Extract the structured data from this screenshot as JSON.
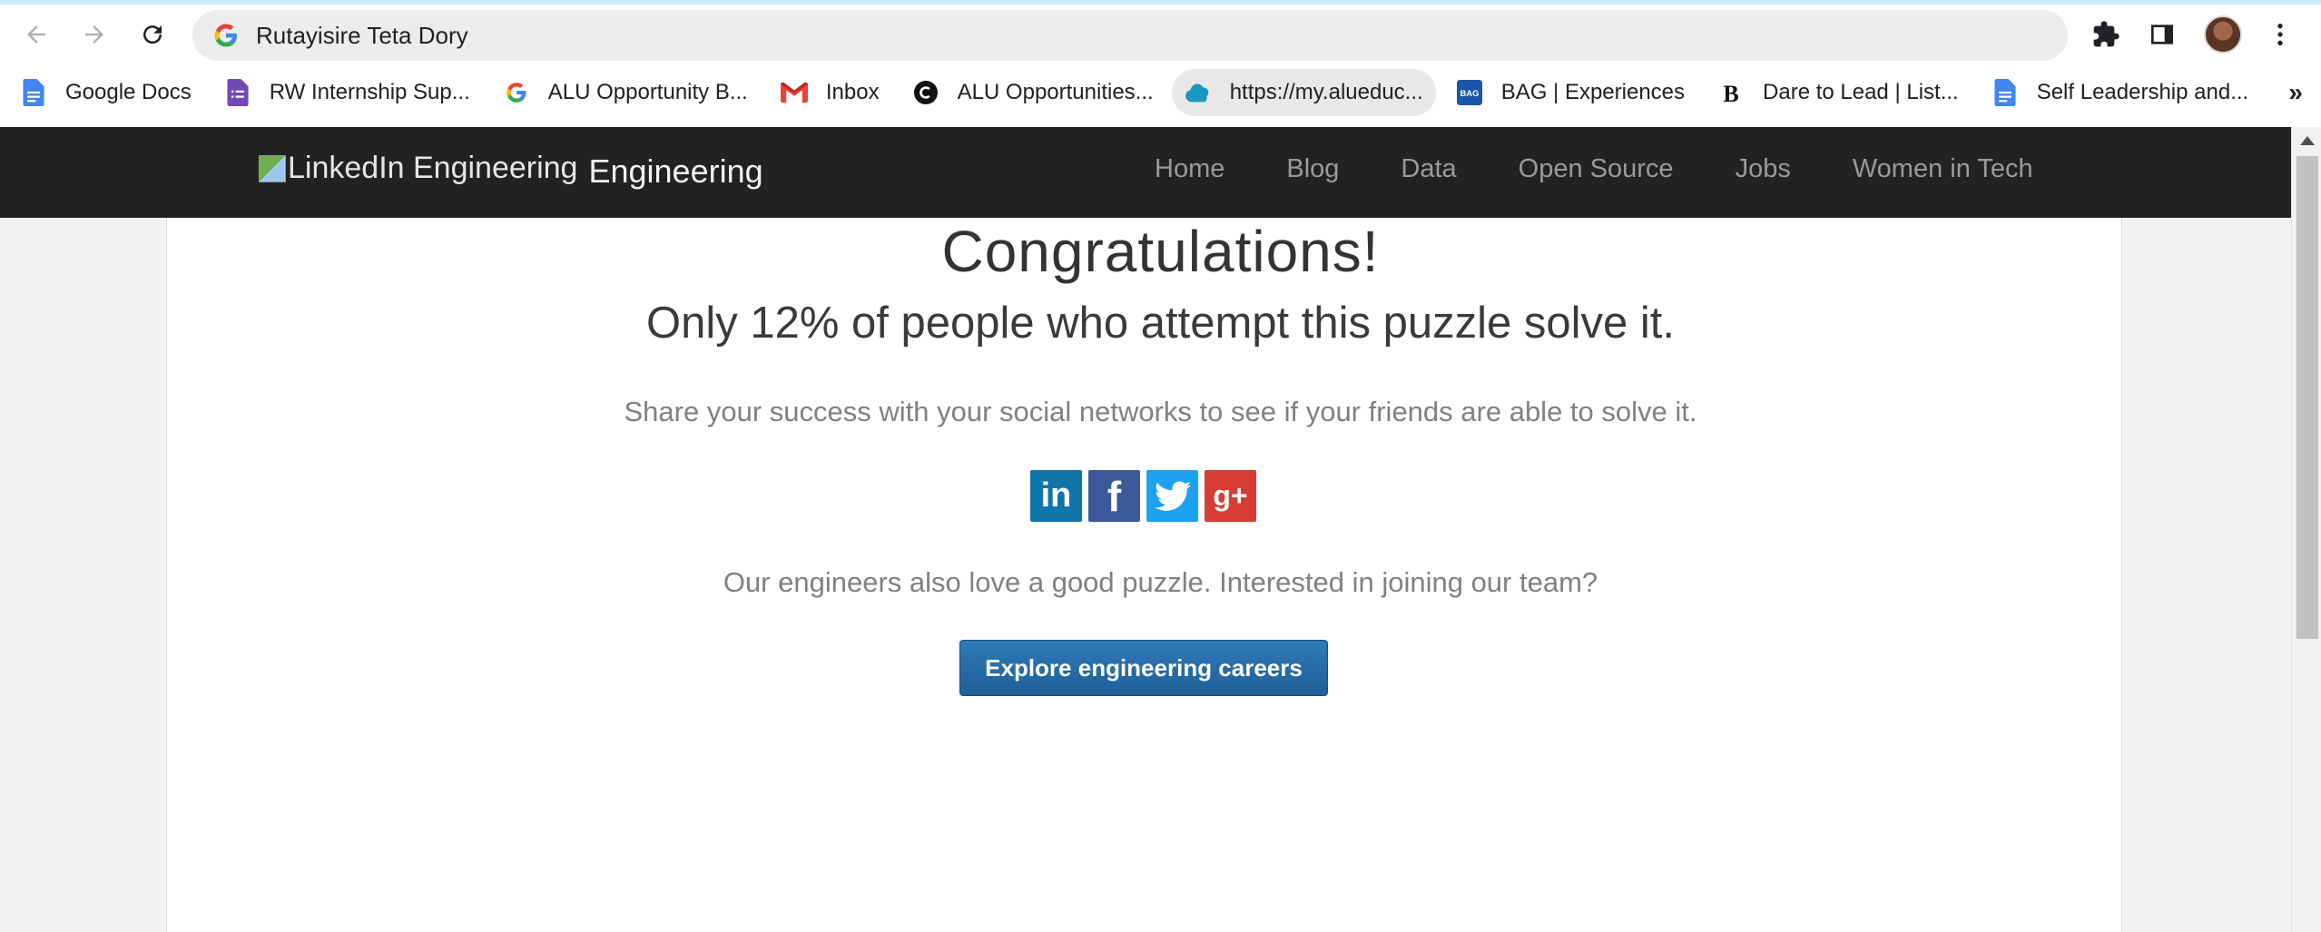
{
  "browser": {
    "omnibox_text": "Rutayisire Teta Dory",
    "bookmarks": [
      {
        "label": "Google Docs",
        "icon": "google-docs-icon"
      },
      {
        "label": "RW Internship Sup...",
        "icon": "google-forms-icon"
      },
      {
        "label": "ALU Opportunity B...",
        "icon": "google-icon"
      },
      {
        "label": "Inbox",
        "icon": "gmail-icon"
      },
      {
        "label": "ALU Opportunities...",
        "icon": "c-circle-icon"
      },
      {
        "label": "https://my.alueduc...",
        "icon": "salesforce-cloud-icon"
      },
      {
        "label": "BAG | Experiences",
        "icon": "bag-icon"
      },
      {
        "label": "Dare to Lead | List...",
        "icon": "b-letter-icon"
      },
      {
        "label": "Self Leadership and...",
        "icon": "google-docs-icon"
      }
    ],
    "more_bookmarks": "»",
    "colors": {
      "loading_bar": "#c6ecf6",
      "omnibox_bg": "#ececec"
    }
  },
  "site": {
    "logo_alt": "LinkedIn Engineering",
    "brand_name": "Engineering",
    "nav": [
      "Home",
      "Blog",
      "Data",
      "Open Source",
      "Jobs",
      "Women in Tech"
    ],
    "colors": {
      "nav_bg": "#222222",
      "cta_bg": "#2e7ab8"
    }
  },
  "main": {
    "title": "Congratulations!",
    "stat": "Only 12% of people who attempt this puzzle solve it.",
    "share_text": "Share your success with your social networks to see if your friends are able to solve it.",
    "social": [
      {
        "label": "in",
        "icon": "linkedin-icon"
      },
      {
        "label": "f",
        "icon": "facebook-icon"
      },
      {
        "label": "",
        "icon": "twitter-icon"
      },
      {
        "label": "g+",
        "icon": "google-plus-icon"
      }
    ],
    "engineers_text": "Our engineers also love a good puzzle. Interested in joining our team?",
    "cta_label": "Explore engineering careers"
  }
}
